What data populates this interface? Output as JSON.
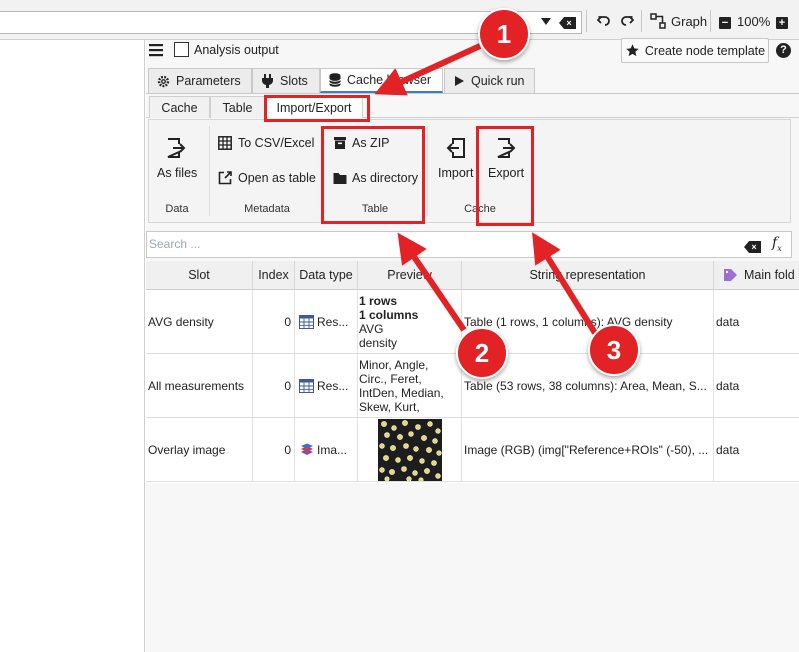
{
  "toolbar": {
    "graph_label": "Graph",
    "zoom_label": "100%"
  },
  "header": {
    "analysis_output_label": "Analysis output",
    "create_node_template_label": "Create node template",
    "help_label": "?"
  },
  "tabs": [
    {
      "label": "Parameters",
      "icon": "gear-icon"
    },
    {
      "label": "Slots",
      "icon": "plug-icon"
    },
    {
      "label": "Cache browser",
      "icon": "database-icon"
    },
    {
      "label": "Quick run",
      "icon": "play-icon"
    }
  ],
  "subtabs": [
    "Cache",
    "Table",
    "Import/Export"
  ],
  "ribbon": {
    "as_files": "As files",
    "to_csv_excel": "To CSV/Excel",
    "open_as_table": "Open as table",
    "as_zip": "As ZIP",
    "as_directory": "As directory",
    "import": "Import",
    "export": "Export",
    "group_data": "Data",
    "group_metadata": "Metadata",
    "group_table": "Table",
    "group_cache": "Cache"
  },
  "search": {
    "placeholder": "Search ..."
  },
  "table": {
    "headers": [
      "Slot",
      "Index",
      "Data type",
      "Preview",
      "String representation",
      "Main fold"
    ],
    "rows": [
      {
        "slot": "AVG density",
        "index": "0",
        "data_type": "Res...",
        "preview_lines": [
          "1 rows",
          "1 columns",
          "AVG",
          "density"
        ],
        "string_repr": "Table (1 rows, 1 columns): AVG density",
        "main_folder": "data"
      },
      {
        "slot": "All measurements",
        "index": "0",
        "data_type": "Res...",
        "preview_lines": [
          "Minor, Angle,",
          "Circ., Feret,",
          "IntDen, Median,",
          "Skew, Kurt,"
        ],
        "string_repr": "Table (53 rows, 38 columns): Area, Mean, S...",
        "main_folder": "data"
      },
      {
        "slot": "Overlay image",
        "index": "0",
        "data_type": "Ima...",
        "preview_lines": [],
        "string_repr": "Image (RGB) (img[\"Reference+ROIs\" (-50), ...",
        "main_folder": "data"
      }
    ]
  },
  "annotations": {
    "callout_1": "1",
    "callout_2": "2",
    "callout_3": "3"
  },
  "colors": {
    "accent_red": "#e32226",
    "tab_underline": "#3a7bd5",
    "tag_purple": "#9b6fd3"
  }
}
